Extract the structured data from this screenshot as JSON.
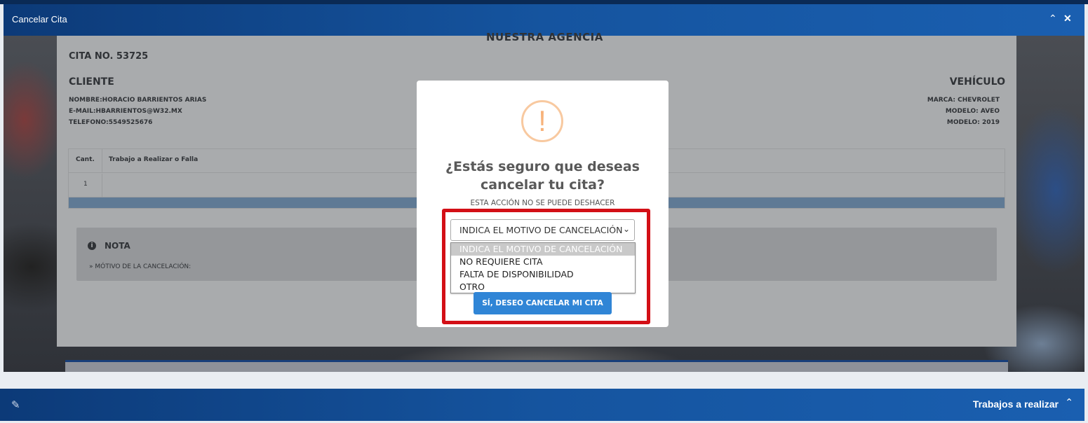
{
  "window": {
    "title": "Cancelar Cita",
    "collapse_icon": "chevron-up-icon",
    "close_icon": "close-icon"
  },
  "document": {
    "agency": "NUESTRA AGENCIA",
    "cita": "CITA NO. 53725",
    "client_heading": "CLIENTE",
    "client_lines": [
      "NOMBRE:HORACIO BARRIENTOS ARIAS",
      "E-MAIL:HBARRIENTOS@W32.MX",
      "TELEFONO:5549525676"
    ],
    "vehicle_heading": "VEHÍCULO",
    "vehicle_lines": [
      "MARCA: CHEVROLET",
      "MODELO: AVEO",
      "MODELO: 2019"
    ],
    "table_headers": [
      "Cant.",
      "Trabajo a Realizar o Falla"
    ],
    "table_rows": [
      [
        "1",
        ""
      ]
    ],
    "note_title": "NOTA",
    "note_text": "» MÓTIVO DE LA CANCELACIÓN:"
  },
  "modal": {
    "icon": "exclamation-icon",
    "question_line1": "¿Estás seguro que deseas",
    "question_line2": "cancelar tu cita?",
    "subtitle": "ESTA ACCIÓN NO SE PUEDE DESHACER",
    "select_value": "INDICA EL MOTIVO DE CANCELACIÓN",
    "options": [
      "INDICA EL MOTIVO DE CANCELACIÓN",
      "NO REQUIERE CITA",
      "FALTA DE DISPONIBILIDAD",
      "OTRO"
    ],
    "confirm_label": "SÍ, DESEO CANCELAR MI CITA",
    "highlight_color": "#d30f16",
    "button_color": "#3085d6"
  },
  "bottom_bar": {
    "label": "Trabajos a realizar",
    "icon": "wrench-icon",
    "toggle_icon": "chevron-up-icon"
  }
}
